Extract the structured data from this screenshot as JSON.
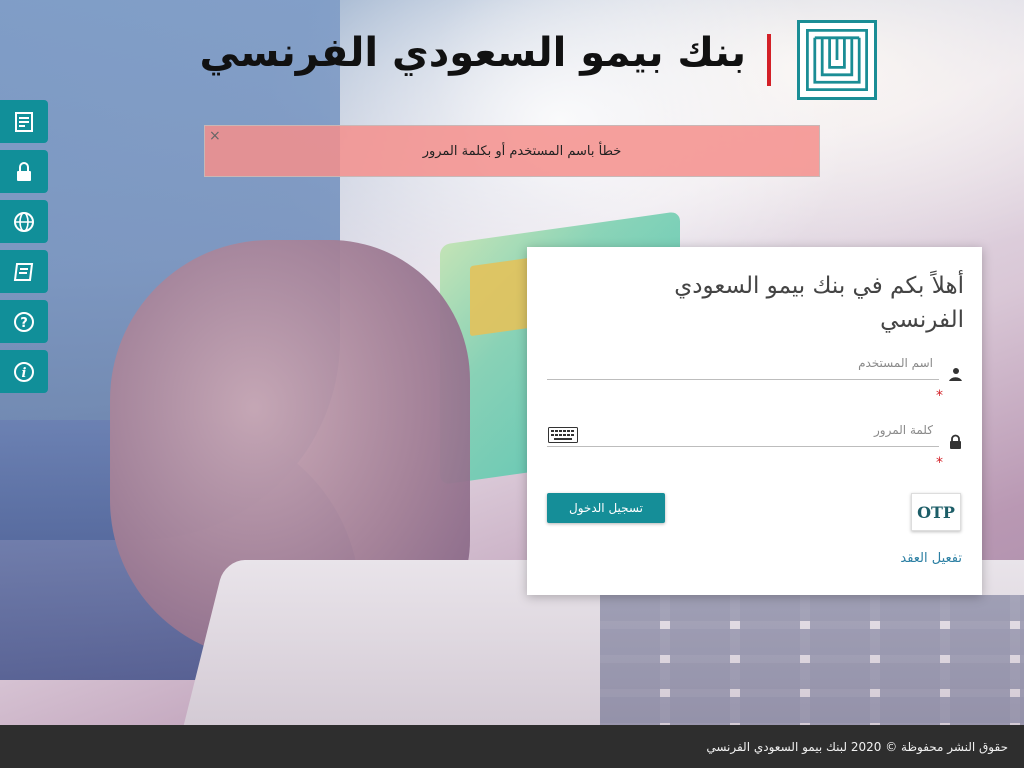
{
  "header": {
    "bank_name": "بنك بيمو السعودي الفرنسي"
  },
  "alert": {
    "message": "خطأ باسم المستخدم أو بكلمة المرور",
    "close_symbol": "×"
  },
  "side_rail": {
    "items": [
      {
        "icon": "form-icon"
      },
      {
        "icon": "lock-icon"
      },
      {
        "icon": "globe-icon"
      },
      {
        "icon": "notes-icon"
      },
      {
        "icon": "help-icon"
      },
      {
        "icon": "info-icon"
      }
    ]
  },
  "login": {
    "welcome": "أهلاً بكم في بنك بيمو السعودي الفرنسي",
    "username_placeholder": "اسم المستخدم",
    "password_placeholder": "كلمة المرور",
    "required_mark": "*",
    "login_label": "تسجيل الدخول",
    "otp_label": "OTP",
    "activate_label": "تفعيل العقد"
  },
  "footer": {
    "copyright": "حقوق النشر محفوظة © 2020 لبنك بيمو السعودي الفرنسي"
  },
  "colors": {
    "accent": "#158e98",
    "divider": "#d32027",
    "alert_bg": "#f48f8c",
    "footer_bg": "#2e2e2e"
  }
}
